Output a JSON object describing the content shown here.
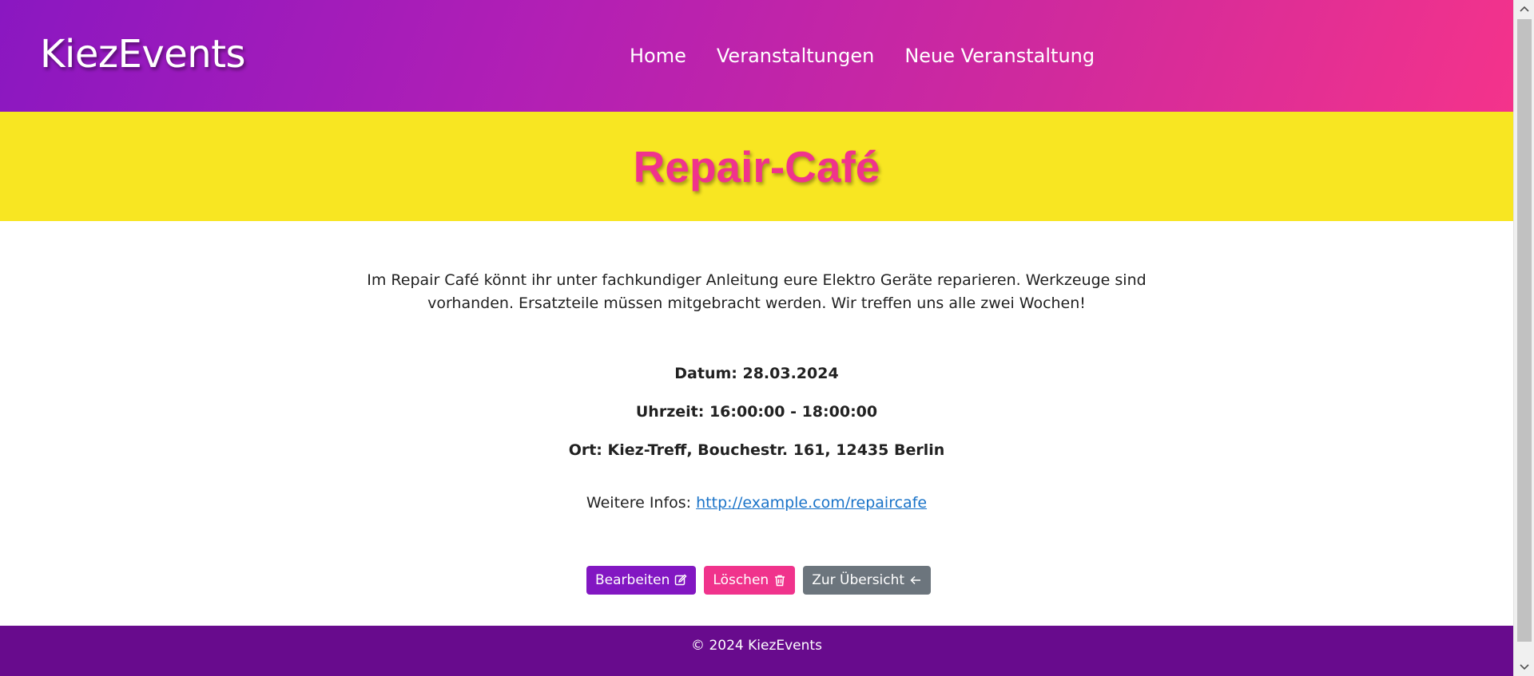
{
  "header": {
    "brand": "KiezEvents",
    "nav": [
      {
        "label": "Home"
      },
      {
        "label": "Veranstaltungen"
      },
      {
        "label": "Neue Veranstaltung"
      }
    ]
  },
  "event": {
    "title": "Repair-Café",
    "description": "Im Repair Café könnt ihr unter fachkundiger Anleitung eure Elektro Geräte reparieren. Werkzeuge sind vorhanden. Ersatzteile müssen mitgebracht werden. Wir treffen uns alle zwei Wochen!",
    "datum": "Datum: 28.03.2024",
    "uhrzeit": "Uhrzeit: 16:00:00 - 18:00:00",
    "ort": "Ort: Kiez-Treff, Bouchestr. 161, 12435 Berlin",
    "more_info_label": "Weitere Infos:",
    "more_info_link": "http://example.com/repaircafe"
  },
  "actions": {
    "edit_label": "Bearbeiten",
    "delete_label": "Löschen",
    "back_label": "Zur Übersicht"
  },
  "footer": {
    "copyright": "© 2024 KiezEvents"
  },
  "icons": {
    "edit": "pencil-square-icon",
    "delete": "trash-icon",
    "back": "arrow-left-icon"
  },
  "colors": {
    "header_gradient_start": "#8a17c1",
    "header_gradient_end": "#f4338b",
    "title_band": "#f8e622",
    "title_text": "#f0338c",
    "edit_button": "#8217c2",
    "delete_button": "#f0338c",
    "back_button": "#6c757d",
    "footer": "#680b8d",
    "link": "#1a73c8"
  }
}
